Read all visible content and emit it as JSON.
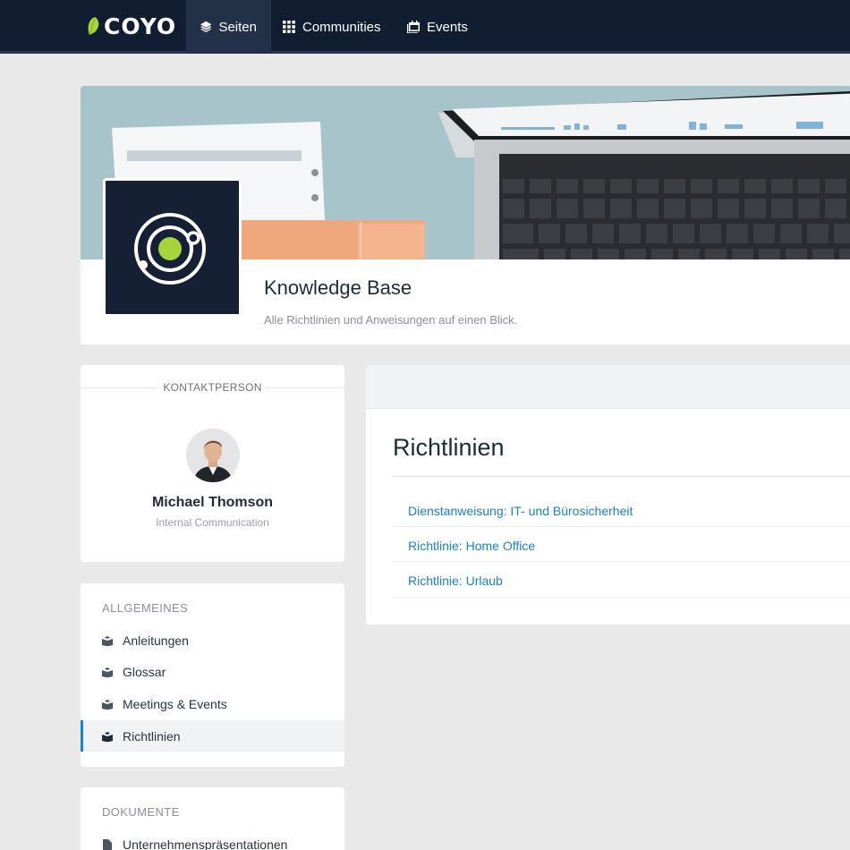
{
  "app": {
    "brand": "COYO",
    "accent": "#1a7fd4",
    "brand_green": "#a6d53b"
  },
  "topnav": {
    "items": [
      {
        "label": "Seiten",
        "icon": "layers-icon",
        "active": true
      },
      {
        "label": "Communities",
        "icon": "grid-icon",
        "active": false
      },
      {
        "label": "Events",
        "icon": "calendar-icon",
        "active": false
      }
    ]
  },
  "page": {
    "title": "Knowledge Base",
    "subtitle": "Alle Richtlinien und Anweisungen auf einen Blick."
  },
  "contact": {
    "heading": "KONTAKTPERSON",
    "name": "Michael Thomson",
    "role": "Internal Communication"
  },
  "sections": {
    "general": {
      "title": "ALLGEMEINES",
      "items": [
        {
          "label": "Anleitungen",
          "icon": "books-icon",
          "active": false
        },
        {
          "label": "Glossar",
          "icon": "books-icon",
          "active": false
        },
        {
          "label": "Meetings & Events",
          "icon": "books-icon",
          "active": false
        },
        {
          "label": "Richtlinien",
          "icon": "books-icon",
          "active": true
        }
      ]
    },
    "docs": {
      "title": "DOKUMENTE",
      "items": [
        {
          "label": "Unternehmenspräsentationen",
          "icon": "file-icon",
          "active": false
        }
      ]
    }
  },
  "main": {
    "title": "Richtlinien",
    "links": [
      "Dienstanweisung: IT- und Bürosicherheit",
      "Richtlinie: Home Office",
      "Richtlinie: Urlaub"
    ]
  }
}
